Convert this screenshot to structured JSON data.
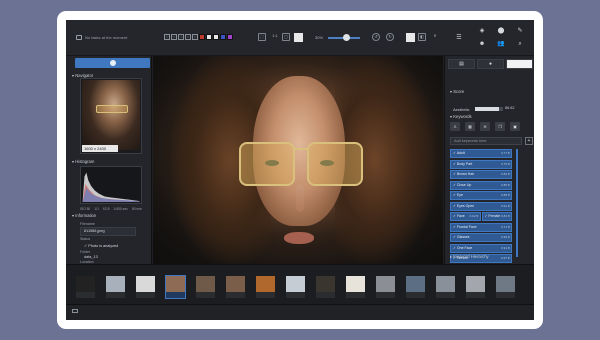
{
  "app": {
    "status_text": "No tasks at the moment"
  },
  "toolbar": {
    "stars": [
      "☆",
      "☆",
      "☆",
      "☆",
      "☆"
    ],
    "color_swatches": [
      "#c0392b",
      "#e6e6e6",
      "#e6e6e6",
      "#3a56c5",
      "#a142c8"
    ],
    "zoom_label": "1:1",
    "zoom_value": "30%",
    "zoom_fraction": 0.55
  },
  "left_panel": {
    "navigator_title": "Navigator",
    "navigator_size": "1600 x 2400",
    "histogram_title": "Histogram",
    "histogram_scale": [
      "ISO 50",
      "1/1",
      "f/2.8",
      "1/400 sec",
      "50 mm"
    ],
    "information_title": "Information",
    "filename_label": "Filename",
    "filename_value": "811586.jpeg",
    "status_label": "Status",
    "status_value": "Photo is analyzed",
    "folder_label": "Folder",
    "folder_value": "data_13",
    "location_label": "Location"
  },
  "right_panel": {
    "score_title": "Score",
    "aesthetic_label": "Aesthetic",
    "aesthetic_value": "86.62",
    "aesthetic_fraction": 0.86,
    "keywords_title": "Keywords",
    "keyword_placeholder": "Add keywords here",
    "keywords": [
      {
        "label": "Adult",
        "score": "0.77"
      },
      {
        "label": "Body Part",
        "score": "0.75"
      },
      {
        "label": "Brown Hair",
        "score": "0.84"
      },
      {
        "label": "Close Up",
        "score": "0.86"
      },
      {
        "label": "Eye",
        "score": "0.88"
      },
      {
        "label": "Eyes Open",
        "score": "0.91"
      }
    ],
    "keyword_pair": [
      {
        "label": "Face",
        "score": "0.92"
      },
      {
        "label": "Female",
        "score": "0.84"
      }
    ],
    "keywords_after": [
      {
        "label": "Frontal Face",
        "score": "0.71"
      },
      {
        "label": "Glasses",
        "score": "0.99"
      },
      {
        "label": "One Face",
        "score": "0.91"
      },
      {
        "label": "Person",
        "score": "0.97"
      },
      {
        "label": "Portrait",
        "score": "0.93"
      }
    ],
    "hierarchy_title": "Keyword Hierarchy"
  },
  "filmstrip": {
    "thumbs": [
      {
        "caption": "",
        "tone": "#222"
      },
      {
        "caption": "",
        "tone": "#a8b0bc"
      },
      {
        "caption": "",
        "tone": "#d9d9d9"
      },
      {
        "caption": "",
        "tone": "#8d6b55"
      },
      {
        "caption": "",
        "tone": "#6f5a4a"
      },
      {
        "caption": "",
        "tone": "#7a5e4a"
      },
      {
        "caption": "",
        "tone": "#b0682d"
      },
      {
        "caption": "",
        "tone": "#c6ccd4"
      },
      {
        "caption": "",
        "tone": "#3b3530"
      },
      {
        "caption": "",
        "tone": "#e7e2da"
      },
      {
        "caption": "",
        "tone": "#8b8f95"
      },
      {
        "caption": "",
        "tone": "#5c6e83"
      },
      {
        "caption": "",
        "tone": "#8a9099"
      },
      {
        "caption": "",
        "tone": "#a3a7ad"
      },
      {
        "caption": "",
        "tone": "#6f7986"
      }
    ],
    "selected_index": 3
  },
  "colors": {
    "accent": "#3f78c0",
    "panel": "#23252a",
    "background": "#6b7293"
  }
}
